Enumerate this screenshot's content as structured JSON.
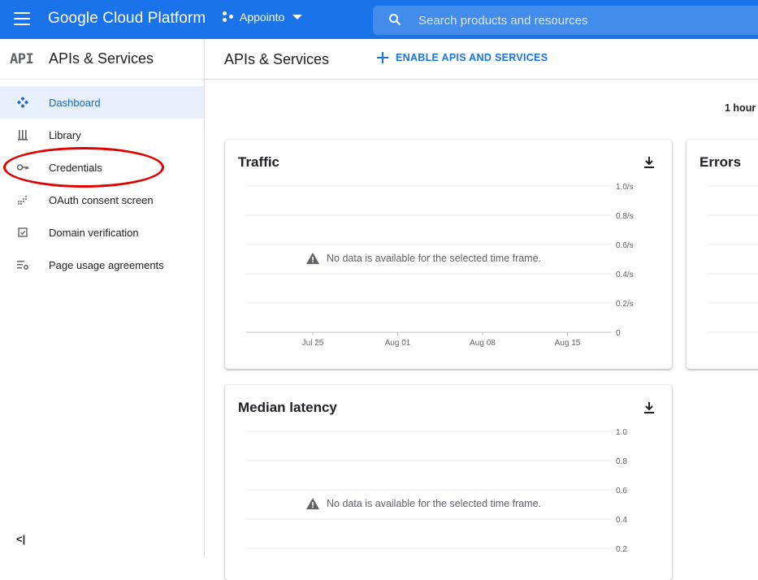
{
  "topbar": {
    "brand": "Google Cloud Platform",
    "project": "Appointo",
    "search_placeholder": "Search products and resources"
  },
  "sidebar": {
    "logo": "API",
    "title": "APIs & Services",
    "items": [
      {
        "label": "Dashboard",
        "icon": "dashboard-icon"
      },
      {
        "label": "Library",
        "icon": "library-icon"
      },
      {
        "label": "Credentials",
        "icon": "key-icon"
      },
      {
        "label": "OAuth consent screen",
        "icon": "oauth-icon"
      },
      {
        "label": "Domain verification",
        "icon": "domain-check-icon"
      },
      {
        "label": "Page usage agreements",
        "icon": "settings-list-icon"
      }
    ],
    "collapse": "<|"
  },
  "main": {
    "title": "APIs & Services",
    "enable_button": "ENABLE APIS AND SERVICES",
    "time_range": "1 hour"
  },
  "cards": {
    "traffic": {
      "title": "Traffic",
      "no_data": "No data is available for the selected time frame.",
      "y_ticks": [
        "1.0/s",
        "0.8/s",
        "0.6/s",
        "0.4/s",
        "0.2/s",
        "0"
      ],
      "x_ticks": [
        "Jul 25",
        "Aug 01",
        "Aug 08",
        "Aug 15"
      ]
    },
    "errors": {
      "title": "Errors"
    },
    "latency": {
      "title": "Median latency",
      "no_data": "No data is available for the selected time frame.",
      "y_ticks": [
        "1.0",
        "0.8",
        "0.6",
        "0.4",
        "0.2"
      ]
    }
  },
  "colors": {
    "brand_blue": "#1a73e8",
    "active_bg": "#e8f0fe",
    "highlight_red": "#e00000"
  }
}
